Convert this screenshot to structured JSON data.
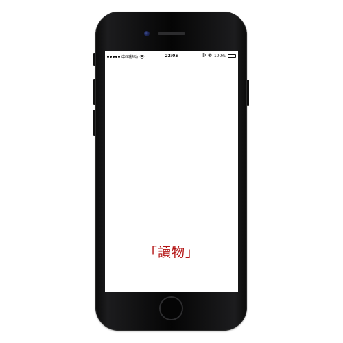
{
  "status_bar": {
    "carrier": "中国移动",
    "time": "22:05",
    "battery_percent": "100%",
    "battery_level": 1.0,
    "battery_color": "#4cd964",
    "icons": [
      "signal-icon",
      "wifi-icon",
      "location-icon",
      "alarm-icon",
      "battery-icon"
    ]
  },
  "app": {
    "logo_text": "「讀物」",
    "logo_color": "#b41414"
  },
  "device": {
    "body_color": "#050505"
  }
}
